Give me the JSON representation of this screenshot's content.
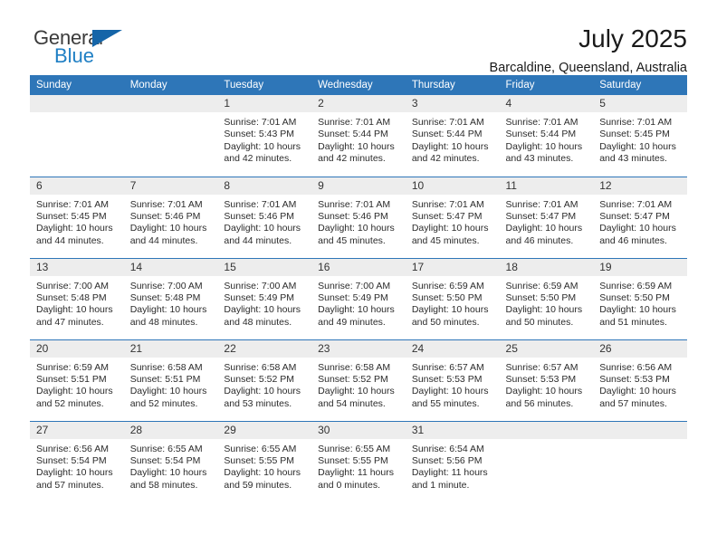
{
  "logo": {
    "primary_text": "General",
    "secondary_text": "Blue",
    "primary_color": "#3b3b3b",
    "secondary_color": "#1f7fc4",
    "triangle_color": "#1565a8"
  },
  "header": {
    "title": "July 2025",
    "subtitle": "Barcaldine, Queensland, Australia"
  },
  "theme": {
    "header_row_bg": "#2e76b8",
    "header_row_text": "#ffffff",
    "daynum_bg": "#ededed",
    "cell_bg": "#ffffff",
    "row_divider": "#2e76b8"
  },
  "weekdays": [
    "Sunday",
    "Monday",
    "Tuesday",
    "Wednesday",
    "Thursday",
    "Friday",
    "Saturday"
  ],
  "weeks": [
    [
      {
        "day": "",
        "empty": true,
        "sunrise": "",
        "sunset": "",
        "daylight_line1": "",
        "daylight_line2": ""
      },
      {
        "day": "",
        "empty": true,
        "sunrise": "",
        "sunset": "",
        "daylight_line1": "",
        "daylight_line2": ""
      },
      {
        "day": "1",
        "sunrise": "Sunrise: 7:01 AM",
        "sunset": "Sunset: 5:43 PM",
        "daylight_line1": "Daylight: 10 hours",
        "daylight_line2": "and 42 minutes."
      },
      {
        "day": "2",
        "sunrise": "Sunrise: 7:01 AM",
        "sunset": "Sunset: 5:44 PM",
        "daylight_line1": "Daylight: 10 hours",
        "daylight_line2": "and 42 minutes."
      },
      {
        "day": "3",
        "sunrise": "Sunrise: 7:01 AM",
        "sunset": "Sunset: 5:44 PM",
        "daylight_line1": "Daylight: 10 hours",
        "daylight_line2": "and 42 minutes."
      },
      {
        "day": "4",
        "sunrise": "Sunrise: 7:01 AM",
        "sunset": "Sunset: 5:44 PM",
        "daylight_line1": "Daylight: 10 hours",
        "daylight_line2": "and 43 minutes."
      },
      {
        "day": "5",
        "sunrise": "Sunrise: 7:01 AM",
        "sunset": "Sunset: 5:45 PM",
        "daylight_line1": "Daylight: 10 hours",
        "daylight_line2": "and 43 minutes."
      }
    ],
    [
      {
        "day": "6",
        "sunrise": "Sunrise: 7:01 AM",
        "sunset": "Sunset: 5:45 PM",
        "daylight_line1": "Daylight: 10 hours",
        "daylight_line2": "and 44 minutes."
      },
      {
        "day": "7",
        "sunrise": "Sunrise: 7:01 AM",
        "sunset": "Sunset: 5:46 PM",
        "daylight_line1": "Daylight: 10 hours",
        "daylight_line2": "and 44 minutes."
      },
      {
        "day": "8",
        "sunrise": "Sunrise: 7:01 AM",
        "sunset": "Sunset: 5:46 PM",
        "daylight_line1": "Daylight: 10 hours",
        "daylight_line2": "and 44 minutes."
      },
      {
        "day": "9",
        "sunrise": "Sunrise: 7:01 AM",
        "sunset": "Sunset: 5:46 PM",
        "daylight_line1": "Daylight: 10 hours",
        "daylight_line2": "and 45 minutes."
      },
      {
        "day": "10",
        "sunrise": "Sunrise: 7:01 AM",
        "sunset": "Sunset: 5:47 PM",
        "daylight_line1": "Daylight: 10 hours",
        "daylight_line2": "and 45 minutes."
      },
      {
        "day": "11",
        "sunrise": "Sunrise: 7:01 AM",
        "sunset": "Sunset: 5:47 PM",
        "daylight_line1": "Daylight: 10 hours",
        "daylight_line2": "and 46 minutes."
      },
      {
        "day": "12",
        "sunrise": "Sunrise: 7:01 AM",
        "sunset": "Sunset: 5:47 PM",
        "daylight_line1": "Daylight: 10 hours",
        "daylight_line2": "and 46 minutes."
      }
    ],
    [
      {
        "day": "13",
        "sunrise": "Sunrise: 7:00 AM",
        "sunset": "Sunset: 5:48 PM",
        "daylight_line1": "Daylight: 10 hours",
        "daylight_line2": "and 47 minutes."
      },
      {
        "day": "14",
        "sunrise": "Sunrise: 7:00 AM",
        "sunset": "Sunset: 5:48 PM",
        "daylight_line1": "Daylight: 10 hours",
        "daylight_line2": "and 48 minutes."
      },
      {
        "day": "15",
        "sunrise": "Sunrise: 7:00 AM",
        "sunset": "Sunset: 5:49 PM",
        "daylight_line1": "Daylight: 10 hours",
        "daylight_line2": "and 48 minutes."
      },
      {
        "day": "16",
        "sunrise": "Sunrise: 7:00 AM",
        "sunset": "Sunset: 5:49 PM",
        "daylight_line1": "Daylight: 10 hours",
        "daylight_line2": "and 49 minutes."
      },
      {
        "day": "17",
        "sunrise": "Sunrise: 6:59 AM",
        "sunset": "Sunset: 5:50 PM",
        "daylight_line1": "Daylight: 10 hours",
        "daylight_line2": "and 50 minutes."
      },
      {
        "day": "18",
        "sunrise": "Sunrise: 6:59 AM",
        "sunset": "Sunset: 5:50 PM",
        "daylight_line1": "Daylight: 10 hours",
        "daylight_line2": "and 50 minutes."
      },
      {
        "day": "19",
        "sunrise": "Sunrise: 6:59 AM",
        "sunset": "Sunset: 5:50 PM",
        "daylight_line1": "Daylight: 10 hours",
        "daylight_line2": "and 51 minutes."
      }
    ],
    [
      {
        "day": "20",
        "sunrise": "Sunrise: 6:59 AM",
        "sunset": "Sunset: 5:51 PM",
        "daylight_line1": "Daylight: 10 hours",
        "daylight_line2": "and 52 minutes."
      },
      {
        "day": "21",
        "sunrise": "Sunrise: 6:58 AM",
        "sunset": "Sunset: 5:51 PM",
        "daylight_line1": "Daylight: 10 hours",
        "daylight_line2": "and 52 minutes."
      },
      {
        "day": "22",
        "sunrise": "Sunrise: 6:58 AM",
        "sunset": "Sunset: 5:52 PM",
        "daylight_line1": "Daylight: 10 hours",
        "daylight_line2": "and 53 minutes."
      },
      {
        "day": "23",
        "sunrise": "Sunrise: 6:58 AM",
        "sunset": "Sunset: 5:52 PM",
        "daylight_line1": "Daylight: 10 hours",
        "daylight_line2": "and 54 minutes."
      },
      {
        "day": "24",
        "sunrise": "Sunrise: 6:57 AM",
        "sunset": "Sunset: 5:53 PM",
        "daylight_line1": "Daylight: 10 hours",
        "daylight_line2": "and 55 minutes."
      },
      {
        "day": "25",
        "sunrise": "Sunrise: 6:57 AM",
        "sunset": "Sunset: 5:53 PM",
        "daylight_line1": "Daylight: 10 hours",
        "daylight_line2": "and 56 minutes."
      },
      {
        "day": "26",
        "sunrise": "Sunrise: 6:56 AM",
        "sunset": "Sunset: 5:53 PM",
        "daylight_line1": "Daylight: 10 hours",
        "daylight_line2": "and 57 minutes."
      }
    ],
    [
      {
        "day": "27",
        "sunrise": "Sunrise: 6:56 AM",
        "sunset": "Sunset: 5:54 PM",
        "daylight_line1": "Daylight: 10 hours",
        "daylight_line2": "and 57 minutes."
      },
      {
        "day": "28",
        "sunrise": "Sunrise: 6:55 AM",
        "sunset": "Sunset: 5:54 PM",
        "daylight_line1": "Daylight: 10 hours",
        "daylight_line2": "and 58 minutes."
      },
      {
        "day": "29",
        "sunrise": "Sunrise: 6:55 AM",
        "sunset": "Sunset: 5:55 PM",
        "daylight_line1": "Daylight: 10 hours",
        "daylight_line2": "and 59 minutes."
      },
      {
        "day": "30",
        "sunrise": "Sunrise: 6:55 AM",
        "sunset": "Sunset: 5:55 PM",
        "daylight_line1": "Daylight: 11 hours",
        "daylight_line2": "and 0 minutes."
      },
      {
        "day": "31",
        "sunrise": "Sunrise: 6:54 AM",
        "sunset": "Sunset: 5:56 PM",
        "daylight_line1": "Daylight: 11 hours",
        "daylight_line2": "and 1 minute."
      },
      {
        "day": "",
        "empty": true,
        "sunrise": "",
        "sunset": "",
        "daylight_line1": "",
        "daylight_line2": ""
      },
      {
        "day": "",
        "empty": true,
        "sunrise": "",
        "sunset": "",
        "daylight_line1": "",
        "daylight_line2": ""
      }
    ]
  ]
}
